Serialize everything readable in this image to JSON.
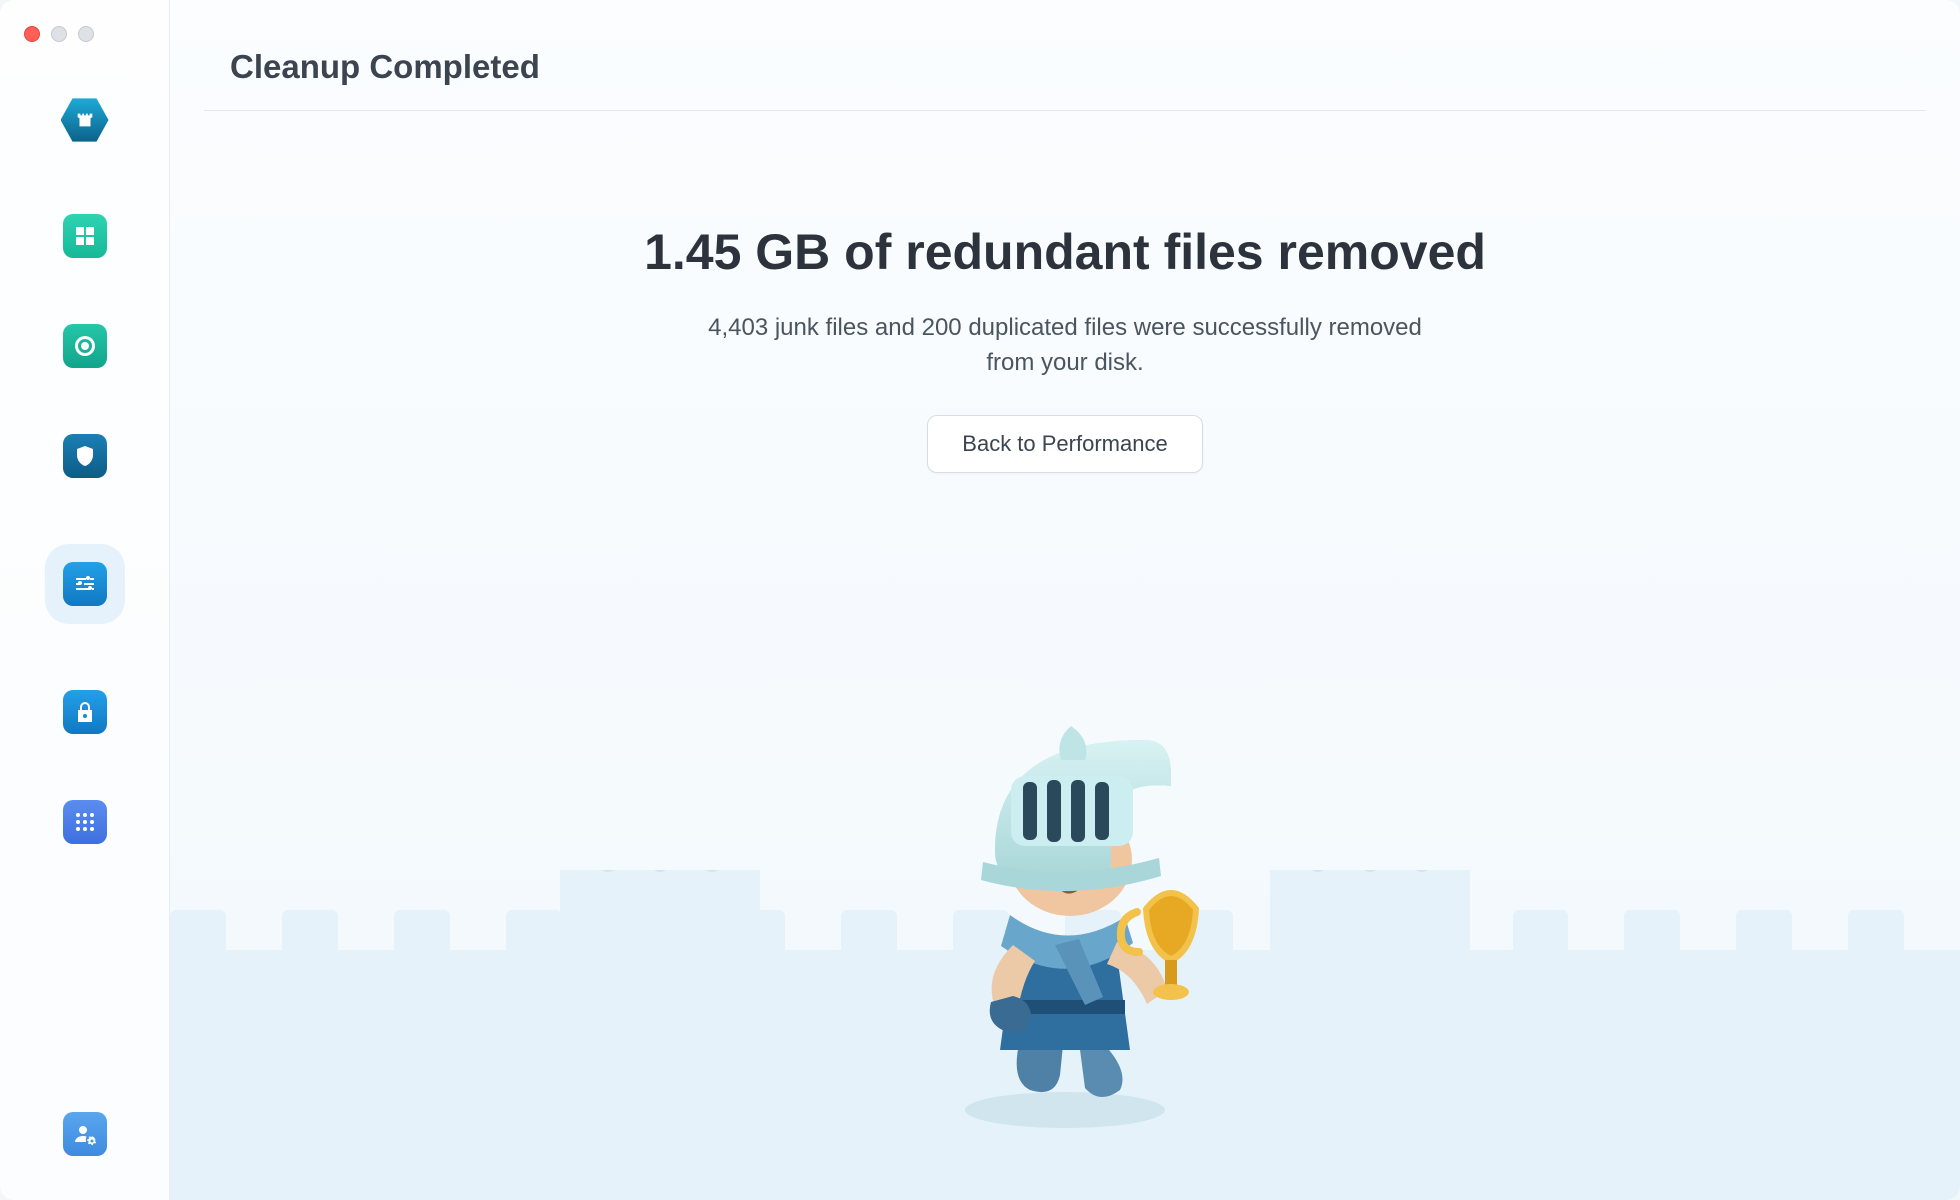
{
  "header": {
    "title": "Cleanup Completed"
  },
  "result": {
    "headline": "1.45 GB of redundant files removed",
    "subline": "4,403 junk files and 200 duplicated files were successfully removed from your disk.",
    "button_label": "Back to Performance"
  },
  "sidebar": {
    "items": [
      {
        "name": "logo",
        "icon": "castle-icon"
      },
      {
        "name": "dashboard",
        "icon": "grid-icon"
      },
      {
        "name": "scan",
        "icon": "target-icon"
      },
      {
        "name": "protection",
        "icon": "shield-icon"
      },
      {
        "name": "performance",
        "icon": "sliders-icon",
        "active": true
      },
      {
        "name": "privacy",
        "icon": "lock-icon"
      },
      {
        "name": "apps",
        "icon": "apps-grid-icon"
      }
    ],
    "footer": {
      "name": "account",
      "icon": "user-gear-icon"
    }
  }
}
